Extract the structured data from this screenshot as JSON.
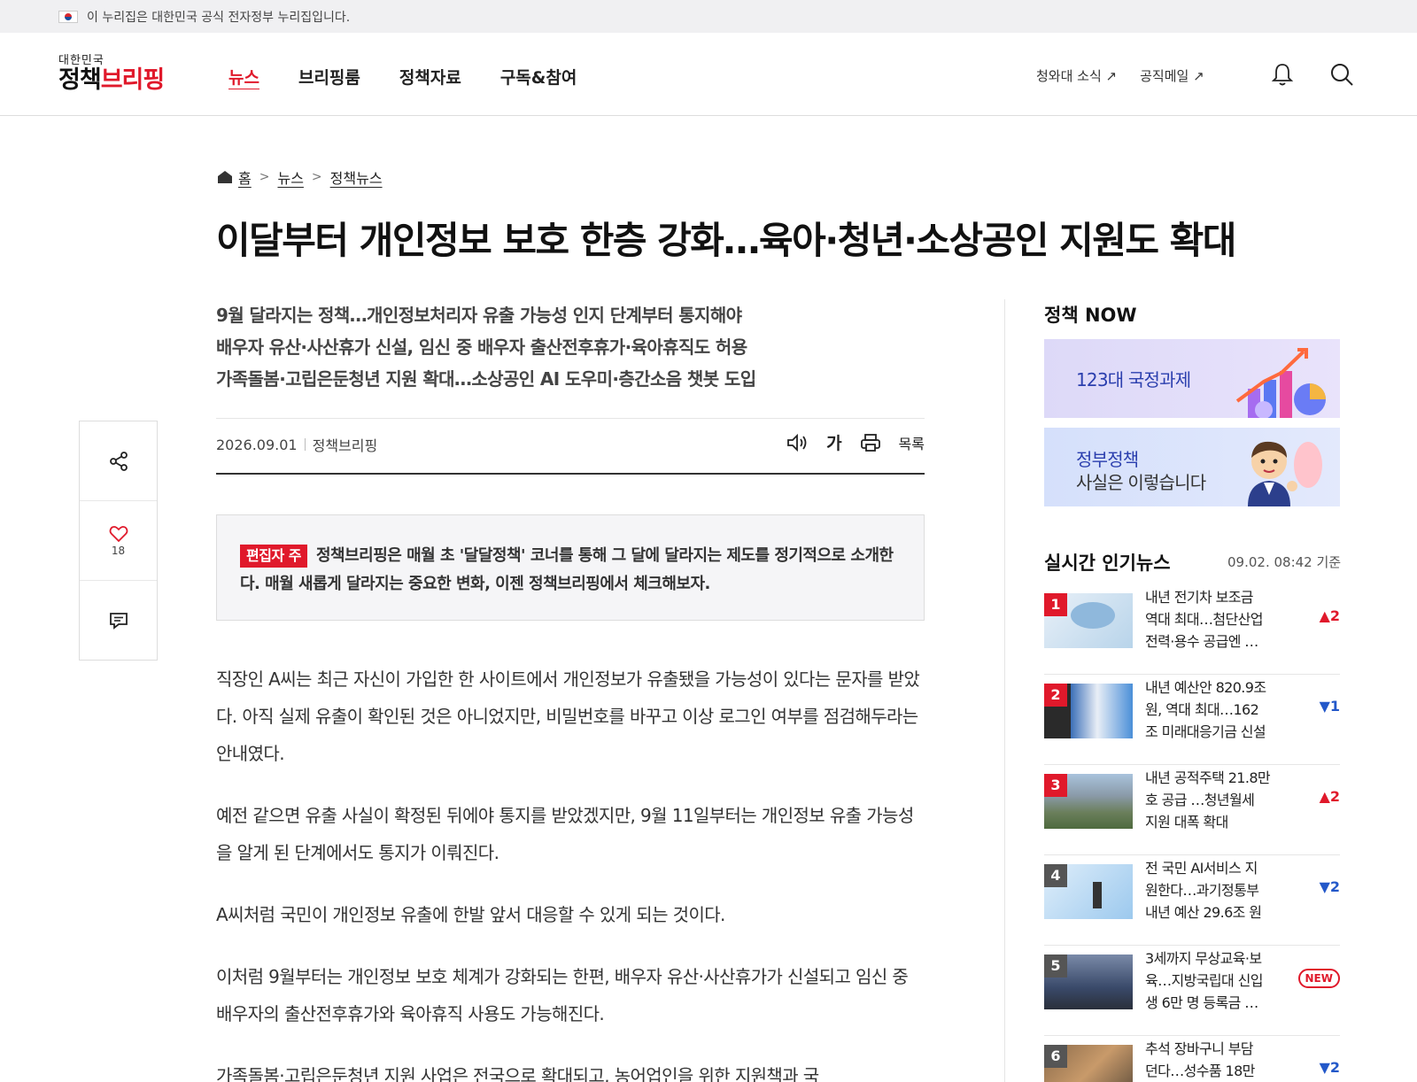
{
  "gov_banner": {
    "text": "이 누리집은 대한민국 공식 전자정부 누리집입니다."
  },
  "header": {
    "logo_small": "대한민국",
    "logo_main_a": "정책",
    "logo_main_b": "브리핑",
    "nav": [
      {
        "label": "뉴스",
        "active": true
      },
      {
        "label": "브리핑룸"
      },
      {
        "label": "정책자료"
      },
      {
        "label": "구독&참여"
      }
    ],
    "links": [
      "청와대 소식 ↗",
      "공직메일 ↗"
    ]
  },
  "breadcrumb": [
    "홈",
    "뉴스",
    "정책뉴스"
  ],
  "article": {
    "title": "이달부터 개인정보 보호 한층 강화…육아·청년·소상공인 지원도 확대",
    "subtitles": [
      "9월 달라지는 정책…개인정보처리자 유출 가능성 인지 단계부터 통지해야",
      "배우자 유산·사산휴가 신설, 임신 중 배우자 출산전후휴가·육아휴직도 허용",
      "가족돌봄·고립은둔청년 지원 확대…소상공인 AI 도우미·층간소음 챗봇 도입"
    ],
    "date": "2026.09.01",
    "source": "정책브리핑",
    "tools": {
      "font": "가",
      "list": "목록"
    },
    "likes": "18",
    "editor_badge": "편집자 주",
    "editor_note": "정책브리핑은 매월 초 '달달정책' 코너를 통해 그 달에 달라지는 제도를 정기적으로 소개한다. 매월 새롭게 달라지는 중요한 변화, 이젠 정책브리핑에서 체크해보자.",
    "paragraphs": [
      "직장인 A씨는 최근 자신이 가입한 한 사이트에서 개인정보가 유출됐을 가능성이 있다는 문자를 받았다. 아직 실제 유출이 확인된 것은 아니었지만, 비밀번호를 바꾸고 이상 로그인 여부를 점검해두라는 안내였다.",
      "예전 같으면 유출 사실이 확정된 뒤에야 통지를 받았겠지만, 9월 11일부터는 개인정보 유출 가능성을 알게 된 단계에서도 통지가 이뤄진다.",
      "A씨처럼 국민이 개인정보 유출에 한발 앞서 대응할 수 있게 되는 것이다.",
      "이처럼 9월부터는 개인정보 보호 체계가 강화되는 한편, 배우자 유산·사산휴가가 신설되고 임신 중 배우자의 출산전후휴가와 육아휴직 사용도 가능해진다.",
      "가족돌봄·고립은둔청년 지원 사업은 전국으로 확대되고, 농어업인을 위한 지원책과 국"
    ]
  },
  "sidebar": {
    "now_title": "정책 NOW",
    "banner1": "123대 국정과제",
    "banner2_line1": "정부정책",
    "banner2_line2": "사실은 이렇습니다",
    "popular_title": "실시간 인기뉴스",
    "popular_time": "09.02. 08:42 기준",
    "popular": [
      {
        "rank": "1",
        "lines": [
          "내년 전기차 보조금",
          "역대 최대…첨단산업",
          "전력·용수 공급엔 …"
        ],
        "trend": "▲2",
        "dir": "up"
      },
      {
        "rank": "2",
        "lines": [
          "내년 예산안 820.9조",
          "원, 역대 최대…162",
          "조 미래대응기금 신설"
        ],
        "trend": "▼1",
        "dir": "down"
      },
      {
        "rank": "3",
        "lines": [
          "내년 공적주택 21.8만",
          "호 공급 …청년월세",
          "지원 대폭 확대"
        ],
        "trend": "▲2",
        "dir": "up"
      },
      {
        "rank": "4",
        "lines": [
          "전 국민 AI서비스 지",
          "원한다…과기정통부",
          "내년 예산 29.6조 원"
        ],
        "trend": "▼2",
        "dir": "down"
      },
      {
        "rank": "5",
        "lines": [
          "3세까지 무상교육·보",
          "육…지방국립대 신입",
          "생 6만 명 등록금 …"
        ],
        "trend": "NEW",
        "dir": "new"
      },
      {
        "rank": "6",
        "lines": [
          "추석 장바구니 부담",
          "던다…성수품 18만",
          ""
        ],
        "trend": "▼2",
        "dir": "down"
      }
    ]
  },
  "colors": {
    "accent": "#e0192b",
    "down": "#2358c9"
  }
}
